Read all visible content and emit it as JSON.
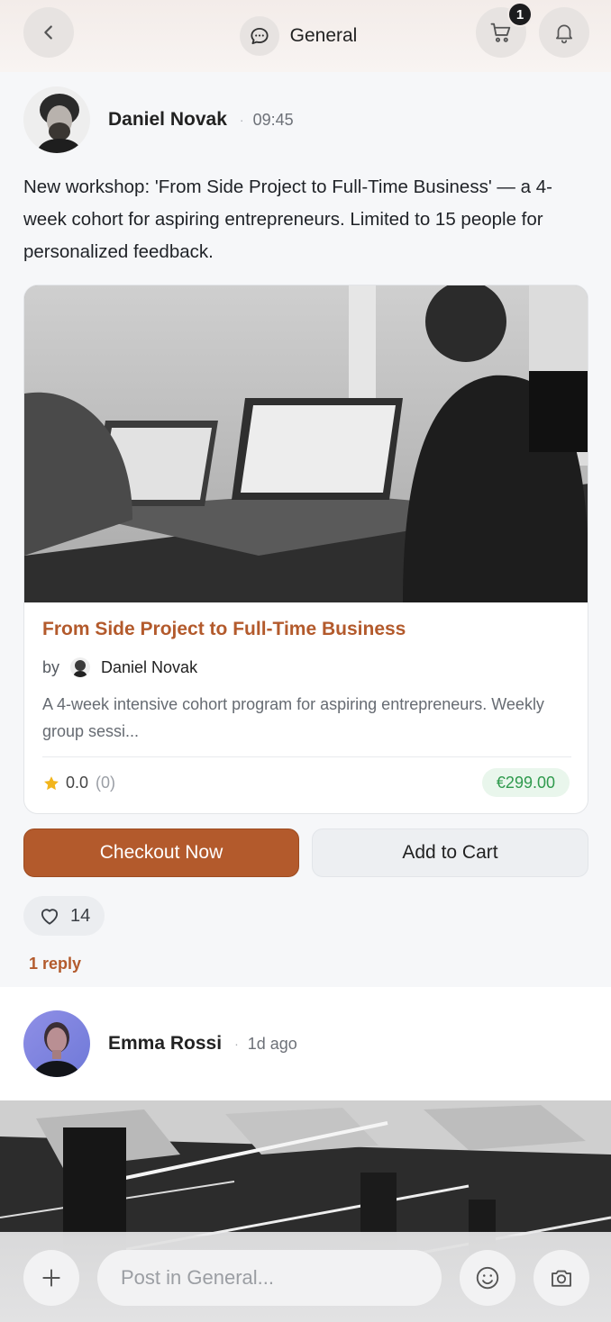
{
  "header": {
    "back_icon": "chevron-left-icon",
    "channel_icon": "chat-bubble-icon",
    "channel_title": "General",
    "cart_icon": "cart-icon",
    "cart_badge": "1",
    "bell_icon": "bell-icon"
  },
  "post1": {
    "author": "Daniel Novak",
    "time": "09:45",
    "separator": "·",
    "text": "New workshop: 'From Side Project to Full-Time Business' — a 4-week cohort for aspiring entrepreneurs. Limited to 15 people for personalized feedback.",
    "card": {
      "title": "From Side Project to Full-Time Business",
      "by_label": "by",
      "by_author": "Daniel Novak",
      "description": "A 4-week intensive cohort program for aspiring entrepreneurs. Weekly group sessi...",
      "rating": "0.0",
      "rating_count": "(0)",
      "price": "€299.00"
    },
    "checkout_label": "Checkout Now",
    "add_to_cart_label": "Add to Cart",
    "likes": "14",
    "replies": "1 reply"
  },
  "post2": {
    "author": "Emma Rossi",
    "separator": "·",
    "time": "1d ago"
  },
  "composer": {
    "placeholder": "Post in General..."
  },
  "colors": {
    "accent": "#b35a2c",
    "price_green": "#2f9a4d",
    "star": "#f2b51c"
  }
}
